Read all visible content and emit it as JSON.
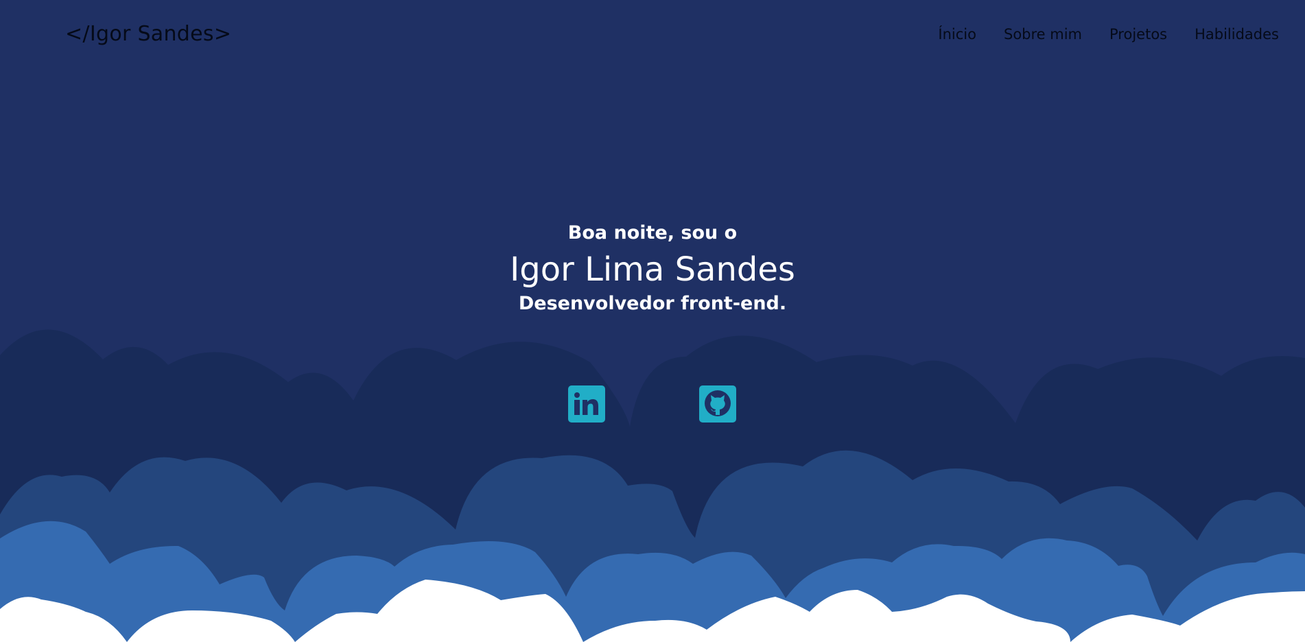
{
  "header": {
    "logo": "</Igor Sandes>",
    "nav": [
      "Ínicio",
      "Sobre mim",
      "Projetos",
      "Habilidades"
    ]
  },
  "hero": {
    "greeting": "Boa noite, sou o",
    "name": "Igor Lima Sandes",
    "role": "Desenvolvedor front-end."
  },
  "social": [
    {
      "name": "linkedin",
      "icon": "linkedin-icon"
    },
    {
      "name": "github",
      "icon": "github-icon"
    }
  ],
  "colors": {
    "background": "#1f3064",
    "clouds_far": "#182b59",
    "clouds_mid": "#24467d",
    "clouds_near": "#356bb1",
    "clouds_front": "#ffffff",
    "icon_accent": "#21aec7",
    "nav_text": "#050a18",
    "hero_text": "#ffffff"
  }
}
